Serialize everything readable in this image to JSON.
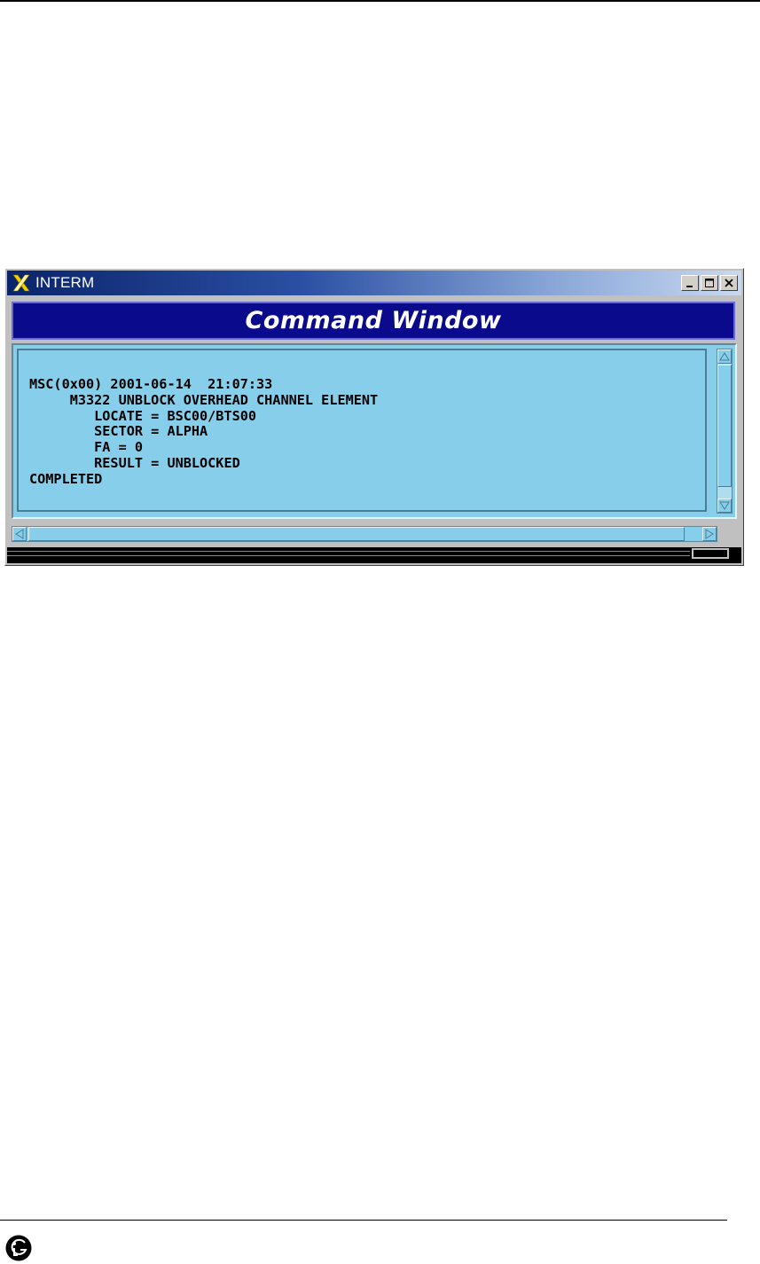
{
  "window": {
    "title": "INTERM",
    "header_title": "Command Window",
    "title_buttons": [
      "minimize",
      "maximize",
      "close"
    ]
  },
  "terminal": {
    "lines": [
      "MSC(0x00) 2001-06-14  21:07:33",
      "     M3322 UNBLOCK OVERHEAD CHANNEL ELEMENT",
      "        LOCATE = BSC00/BTS00",
      "        SECTOR = ALPHA",
      "        FA = 0",
      "        RESULT = UNBLOCKED",
      "COMPLETED"
    ]
  },
  "colors": {
    "terminal_bg": "#87ceeb",
    "header_bg": "#0a0a8c",
    "titlebar_start": "#0a246a",
    "titlebar_end": "#c8d8f0",
    "logo": "#000000"
  },
  "icons": {
    "app_icon": "x-window-icon",
    "logo": "lg-logo-icon"
  }
}
